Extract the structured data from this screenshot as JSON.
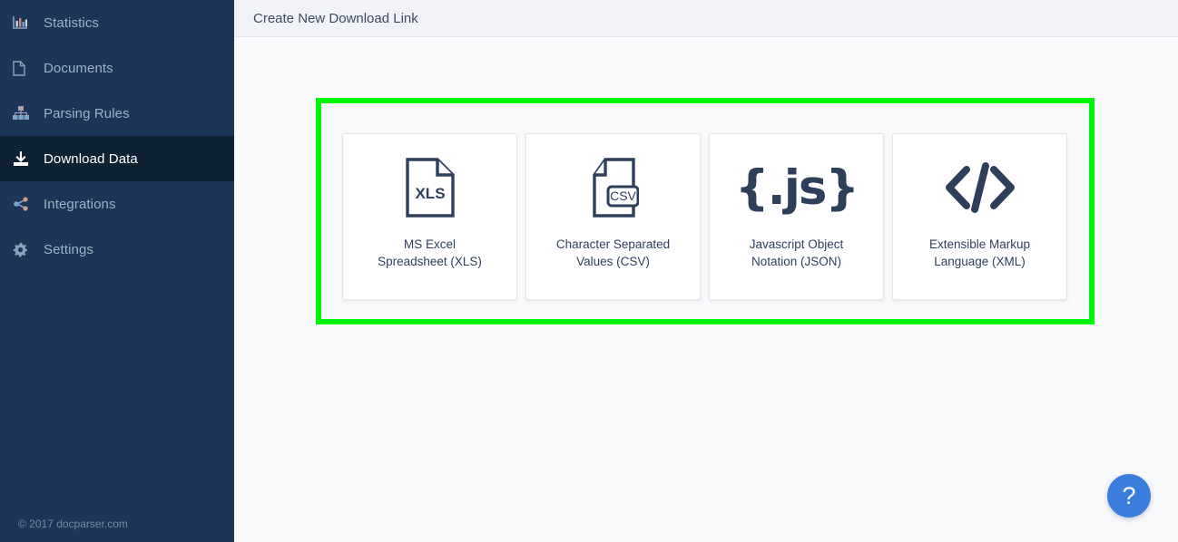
{
  "sidebar": {
    "items": [
      {
        "label": "Statistics",
        "icon": "bar-chart-icon",
        "active": false
      },
      {
        "label": "Documents",
        "icon": "file-icon",
        "active": false
      },
      {
        "label": "Parsing Rules",
        "icon": "sitemap-icon",
        "active": false
      },
      {
        "label": "Download Data",
        "icon": "download-icon",
        "active": true
      },
      {
        "label": "Integrations",
        "icon": "share-icon",
        "active": false
      },
      {
        "label": "Settings",
        "icon": "gear-icon",
        "active": false
      }
    ],
    "footer": "© 2017 docparser.com",
    "background_color": "#1d3557",
    "active_background_color": "#0f2234"
  },
  "header": {
    "title": "Create New Download Link"
  },
  "highlight": {
    "color": "#00f504"
  },
  "formats": [
    {
      "icon": "xls-file-icon",
      "icon_text": "XLS",
      "label": "MS Excel\nSpreadsheet (XLS)"
    },
    {
      "icon": "csv-file-icon",
      "icon_text": "CSV",
      "label": "Character Separated\nValues (CSV)"
    },
    {
      "icon": "json-js-icon",
      "icon_text": "{.js}",
      "label": "Javascript Object\nNotation (JSON)"
    },
    {
      "icon": "xml-code-icon",
      "icon_text": "</>",
      "label": "Extensible Markup\nLanguage (XML)"
    }
  ],
  "help": {
    "label": "?",
    "color": "#3b7ddd"
  }
}
